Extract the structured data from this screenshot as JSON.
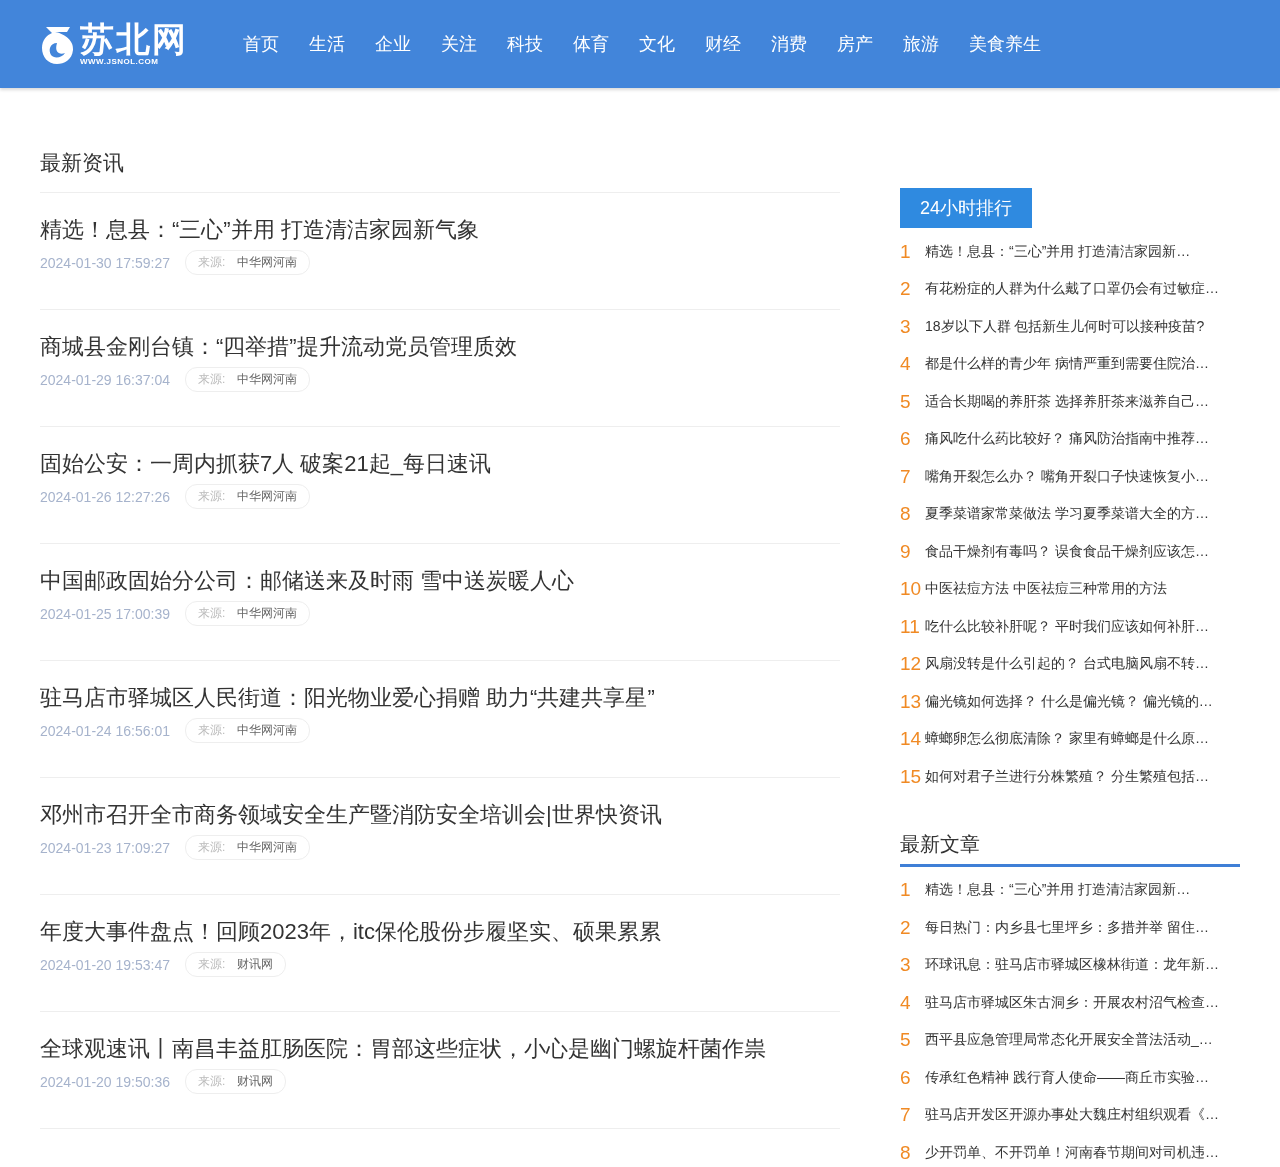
{
  "header": {
    "logo_name": "苏北网",
    "logo_url": "WWW.JSNOL.COM",
    "nav": [
      {
        "label": "首页"
      },
      {
        "label": "生活"
      },
      {
        "label": "企业"
      },
      {
        "label": "关注"
      },
      {
        "label": "科技"
      },
      {
        "label": "体育"
      },
      {
        "label": "文化"
      },
      {
        "label": "财经"
      },
      {
        "label": "消费"
      },
      {
        "label": "房产"
      },
      {
        "label": "旅游"
      },
      {
        "label": "美食养生"
      }
    ]
  },
  "news": {
    "title": "最新资讯",
    "items": [
      {
        "title": "精选！息县：“三心”并用 打造清洁家园新气象",
        "time": "2024-01-30 17:59:27",
        "source_label": "来源:",
        "source": "中华网河南"
      },
      {
        "title": "商城县金刚台镇：“四举措”提升流动党员管理质效",
        "time": "2024-01-29 16:37:04",
        "source_label": "来源:",
        "source": "中华网河南"
      },
      {
        "title": "固始公安：一周内抓获7人 破案21起_每日速讯",
        "time": "2024-01-26 12:27:26",
        "source_label": "来源:",
        "source": "中华网河南"
      },
      {
        "title": "中国邮政固始分公司：邮储送来及时雨 雪中送炭暖人心",
        "time": "2024-01-25 17:00:39",
        "source_label": "来源:",
        "source": "中华网河南"
      },
      {
        "title": "驻马店市驿城区人民街道：阳光物业爱心捐赠 助力“共建共享星”",
        "time": "2024-01-24 16:56:01",
        "source_label": "来源:",
        "source": "中华网河南"
      },
      {
        "title": "邓州市召开全市商务领域安全生产暨消防安全培训会|世界快资讯",
        "time": "2024-01-23 17:09:27",
        "source_label": "来源:",
        "source": "中华网河南"
      },
      {
        "title": "年度大事件盘点！回顾2023年，itc保伦股份步履坚实、硕果累累",
        "time": "2024-01-20 19:53:47",
        "source_label": "来源:",
        "source": "财讯网"
      },
      {
        "title": "全球观速讯丨南昌丰益肛肠医院：胃部这些症状，小心是幽门螺旋杆菌作祟",
        "time": "2024-01-20 19:50:36",
        "source_label": "来源:",
        "source": "财讯网"
      }
    ]
  },
  "ranking": {
    "title": "24小时排行",
    "items": [
      {
        "rank": "1",
        "title": "精选！息县：“三心”并用 打造清洁家园新…"
      },
      {
        "rank": "2",
        "title": "有花粉症的人群为什么戴了口罩仍会有过敏症…"
      },
      {
        "rank": "3",
        "title": "18岁以下人群 包括新生儿何时可以接种疫苗?"
      },
      {
        "rank": "4",
        "title": "都是什么样的青少年 病情严重到需要住院治…"
      },
      {
        "rank": "5",
        "title": "适合长期喝的养肝茶 选择养肝茶来滋养自己…"
      },
      {
        "rank": "6",
        "title": "痛风吃什么药比较好？ 痛风防治指南中推荐…"
      },
      {
        "rank": "7",
        "title": "嘴角开裂怎么办？ 嘴角开裂口子快速恢复小…"
      },
      {
        "rank": "8",
        "title": "夏季菜谱家常菜做法 学习夏季菜谱大全的方…"
      },
      {
        "rank": "9",
        "title": "食品干燥剂有毒吗？ 误食食品干燥剂应该怎…"
      },
      {
        "rank": "10",
        "title": "中医祛痘方法 中医祛痘三种常用的方法"
      },
      {
        "rank": "11",
        "title": "吃什么比较补肝呢？ 平时我们应该如何补肝…"
      },
      {
        "rank": "12",
        "title": "风扇没转是什么引起的？ 台式电脑风扇不转…"
      },
      {
        "rank": "13",
        "title": "偏光镜如何选择？ 什么是偏光镜？ 偏光镜的…"
      },
      {
        "rank": "14",
        "title": "蟑螂卵怎么彻底清除？ 家里有蟑螂是什么原…"
      },
      {
        "rank": "15",
        "title": "如何对君子兰进行分株繁殖？ 分生繁殖包括…"
      }
    ]
  },
  "latest": {
    "title": "最新文章",
    "items": [
      {
        "rank": "1",
        "title": "精选！息县：“三心”并用 打造清洁家园新…"
      },
      {
        "rank": "2",
        "title": "每日热门：内乡县七里坪乡：多措并举 留住…"
      },
      {
        "rank": "3",
        "title": "环球讯息：驻马店市驿城区橡林街道：龙年新…"
      },
      {
        "rank": "4",
        "title": "驻马店市驿城区朱古洞乡：开展农村沼气检查…"
      },
      {
        "rank": "5",
        "title": "西平县应急管理局常态化开展安全普法活动_…"
      },
      {
        "rank": "6",
        "title": "传承红色精神 践行育人使命——商丘市实验…"
      },
      {
        "rank": "7",
        "title": "驻马店开发区开源办事处大魏庄村组织观看《…"
      },
      {
        "rank": "8",
        "title": "少开罚单、不开罚单！河南春节期间对司机违…"
      }
    ]
  }
}
